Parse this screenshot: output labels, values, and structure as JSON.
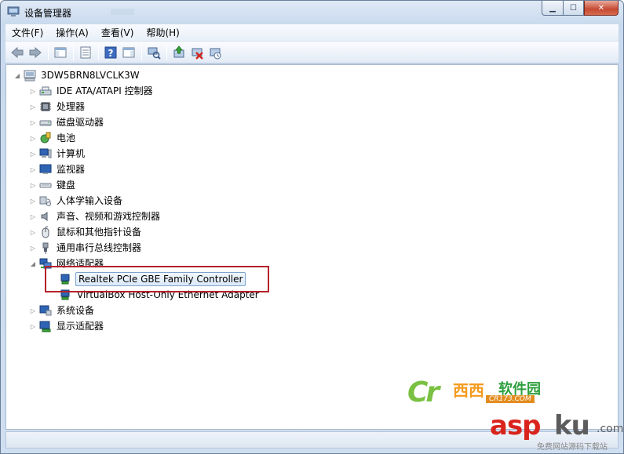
{
  "window": {
    "title": "设备管理器"
  },
  "menu": [
    "文件(F)",
    "操作(A)",
    "查看(V)",
    "帮助(H)"
  ],
  "toolbar_icons": [
    "back-arrow-icon",
    "forward-arrow-icon",
    "show-hide-console-tree-icon",
    "properties-icon",
    "help-icon",
    "action-pane-icon",
    "scan-hardware-icon",
    "update-driver-icon",
    "uninstall-icon",
    "disable-device-icon"
  ],
  "tree": {
    "root": "3DW5BRN8LVCLK3W",
    "categories": [
      {
        "label": "IDE ATA/ATAPI 控制器",
        "icon": "ide-controller-icon",
        "expanded": false
      },
      {
        "label": "处理器",
        "icon": "processor-icon",
        "expanded": false
      },
      {
        "label": "磁盘驱动器",
        "icon": "disk-drive-icon",
        "expanded": false
      },
      {
        "label": "电池",
        "icon": "battery-icon",
        "expanded": false
      },
      {
        "label": "计算机",
        "icon": "computer-icon",
        "expanded": false
      },
      {
        "label": "监视器",
        "icon": "monitor-icon",
        "expanded": false
      },
      {
        "label": "键盘",
        "icon": "keyboard-icon",
        "expanded": false
      },
      {
        "label": "人体学输入设备",
        "icon": "hid-icon",
        "expanded": false
      },
      {
        "label": "声音、视频和游戏控制器",
        "icon": "sound-icon",
        "expanded": false
      },
      {
        "label": "鼠标和其他指针设备",
        "icon": "mouse-icon",
        "expanded": false
      },
      {
        "label": "通用串行总线控制器",
        "icon": "usb-icon",
        "expanded": false
      },
      {
        "label": "网络适配器",
        "icon": "network-adapter-icon",
        "expanded": true,
        "children": [
          {
            "label": "Realtek PCIe GBE Family Controller",
            "selected": true
          },
          {
            "label": "VirtualBox Host-Only Ethernet Adapter",
            "selected": false
          }
        ]
      },
      {
        "label": "系统设备",
        "icon": "system-device-icon",
        "expanded": false
      },
      {
        "label": "显示适配器",
        "icon": "display-adapter-icon",
        "expanded": false
      }
    ]
  },
  "watermarks": {
    "cr173": {
      "logo": "Cr",
      "name_a": "西西",
      "name_b": "软件园",
      "domain": "CR173.COM"
    },
    "aspku": {
      "a": "asp",
      "b": "ku",
      "c": ".com",
      "sub": "免费网站源码下载站"
    }
  },
  "colors": {
    "highlight_box": "#b5222a",
    "selection_border": "#7da2ce"
  }
}
